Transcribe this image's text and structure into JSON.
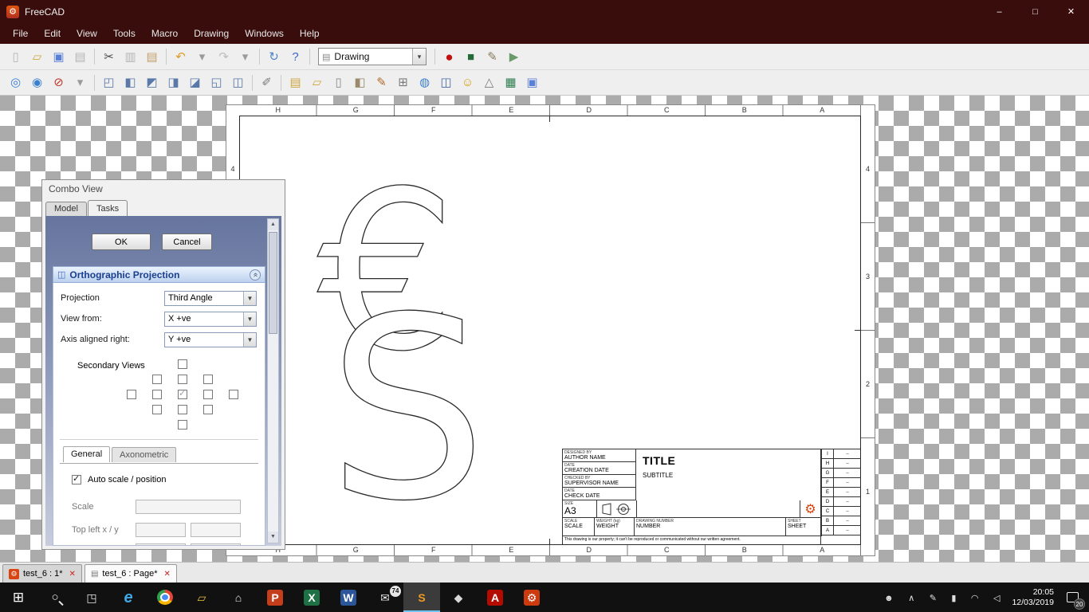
{
  "window": {
    "title": "FreeCAD",
    "controls": {
      "minimize": "–",
      "maximize": "□",
      "close": "✕"
    }
  },
  "menubar": {
    "items": [
      "File",
      "Edit",
      "View",
      "Tools",
      "Macro",
      "Drawing",
      "Windows",
      "Help"
    ]
  },
  "toolbar1": {
    "workbench": "Drawing",
    "workbench_icon": "▤",
    "workbench_caret": "▾",
    "items": [
      {
        "name": "new-document-button",
        "glyph": "▯",
        "color": "#b5b5b5"
      },
      {
        "name": "open-document-button",
        "glyph": "▱",
        "color": "#cfa63f"
      },
      {
        "name": "save-button",
        "glyph": "▣",
        "color": "#5a7fd6"
      },
      {
        "name": "print-button",
        "glyph": "▤",
        "color": "#b5b5b5"
      },
      {
        "name": "separator",
        "sep": true,
        "inter": "false"
      },
      {
        "name": "cut-button",
        "glyph": "✂",
        "color": "#4a4a4a"
      },
      {
        "name": "copy-button",
        "glyph": "▥",
        "color": "#b5b5b5"
      },
      {
        "name": "paste-button",
        "glyph": "▤",
        "color": "#c2a06a"
      },
      {
        "name": "separator",
        "sep": true,
        "inter": "false"
      },
      {
        "name": "undo-button",
        "glyph": "↶",
        "color": "#e09a2a"
      },
      {
        "name": "undo-dropdown",
        "glyph": "▾",
        "color": "#9a9a9a"
      },
      {
        "name": "redo-button",
        "glyph": "↷",
        "color": "#bdbdbd"
      },
      {
        "name": "redo-dropdown",
        "glyph": "▾",
        "color": "#9a9a9a"
      },
      {
        "name": "separator",
        "sep": true,
        "inter": "false"
      },
      {
        "name": "refresh-button",
        "glyph": "↻",
        "color": "#4a86c8"
      },
      {
        "name": "whats-this-button",
        "glyph": "?",
        "color": "#3a66c8"
      },
      {
        "name": "separator",
        "sep": true,
        "inter": "false"
      }
    ],
    "macro_items": [
      {
        "name": "separator",
        "sep": true,
        "inter": "false"
      },
      {
        "name": "macro-record-button",
        "glyph": "●",
        "color": "#c01010"
      },
      {
        "name": "macro-stop-button",
        "glyph": "■",
        "color": "#256b38"
      },
      {
        "name": "macro-edit-button",
        "glyph": "✎",
        "color": "#8a7a5a"
      },
      {
        "name": "macro-execute-button",
        "glyph": "▶",
        "color": "#6a9a6a"
      }
    ]
  },
  "toolbar2": {
    "items": [
      {
        "name": "fit-all-button",
        "glyph": "◎",
        "color": "#3a7fd0"
      },
      {
        "name": "zoom-selection-button",
        "glyph": "◉",
        "color": "#3a7fd0"
      },
      {
        "name": "draw-style-button",
        "glyph": "⊘",
        "color": "#c0392b"
      },
      {
        "name": "draw-style-dropdown",
        "glyph": "▾",
        "color": "#9a9a9a"
      },
      {
        "name": "separator",
        "sep": true,
        "inter": "false"
      },
      {
        "name": "view-axonometric-button",
        "glyph": "◰",
        "color": "#5b79a8"
      },
      {
        "name": "view-front-button",
        "glyph": "◧",
        "color": "#5b79a8"
      },
      {
        "name": "view-top-button",
        "glyph": "◩",
        "color": "#5b79a8"
      },
      {
        "name": "view-right-button",
        "glyph": "◨",
        "color": "#5b79a8"
      },
      {
        "name": "view-rear-button",
        "glyph": "◪",
        "color": "#5b79a8"
      },
      {
        "name": "view-bottom-button",
        "glyph": "◱",
        "color": "#5b79a8"
      },
      {
        "name": "view-left-button",
        "glyph": "◫",
        "color": "#5b79a8"
      },
      {
        "name": "separator",
        "sep": true,
        "inter": "false"
      },
      {
        "name": "measure-distance-button",
        "glyph": "✐",
        "color": "#7a7a7a"
      },
      {
        "name": "separator",
        "sep": true,
        "inter": "false"
      },
      {
        "name": "drawing-new-page-button",
        "glyph": "▤",
        "color": "#cfa63f"
      },
      {
        "name": "drawing-open-svg-button",
        "glyph": "▱",
        "color": "#cfa63f"
      },
      {
        "name": "drawing-new-a3-page-button",
        "glyph": "▯",
        "color": "#8a8a8a"
      },
      {
        "name": "drawing-insert-view-button",
        "glyph": "◧",
        "color": "#9a8a6a"
      },
      {
        "name": "drawing-annotation-button",
        "glyph": "✎",
        "color": "#b06a2a"
      },
      {
        "name": "drawing-clip-button",
        "glyph": "⊞",
        "color": "#7a7a7a"
      },
      {
        "name": "drawing-open-browser-button",
        "glyph": "◍",
        "color": "#3a7fd0"
      },
      {
        "name": "drawing-ortho-views-button",
        "glyph": "◫",
        "color": "#4a6aa8"
      },
      {
        "name": "drawing-symbol-button",
        "glyph": "☺",
        "color": "#d6a018"
      },
      {
        "name": "drawing-draft-view-button",
        "glyph": "△",
        "color": "#7a7a7a"
      },
      {
        "name": "drawing-spreadsheet-view-button",
        "glyph": "▦",
        "color": "#2e7d4f"
      },
      {
        "name": "drawing-save-page-button",
        "glyph": "▣",
        "color": "#5a7fd6"
      }
    ]
  },
  "combo_view": {
    "title": "Combo View",
    "tabs": [
      {
        "name": "tab-model",
        "label": "Model"
      },
      {
        "name": "tab-tasks",
        "label": "Tasks",
        "active": true
      }
    ],
    "ok_label": "OK",
    "cancel_label": "Cancel",
    "section_icon": "◫",
    "section_title": "Orthographic Projection",
    "collapse_glyph": "«",
    "rows": [
      {
        "label": "Projection",
        "value": "Third Angle"
      },
      {
        "label": "View from:",
        "value": "X +ve"
      },
      {
        "label": "Axis aligned right:",
        "value": "Y +ve"
      }
    ],
    "secondary_views_label": "Secondary Views",
    "checkbox_grid": [
      {
        "s": "n"
      },
      {
        "s": "n"
      },
      {
        "s": "o"
      },
      {
        "s": "n"
      },
      {
        "s": "n"
      },
      {
        "s": "n"
      },
      {
        "s": "o"
      },
      {
        "s": "o"
      },
      {
        "s": "o"
      },
      {
        "s": "n"
      },
      {
        "s": "o"
      },
      {
        "s": "o"
      },
      {
        "s": "c"
      },
      {
        "s": "o"
      },
      {
        "s": "o"
      },
      {
        "s": "n"
      },
      {
        "s": "o"
      },
      {
        "s": "o"
      },
      {
        "s": "o"
      },
      {
        "s": "n"
      },
      {
        "s": "n"
      },
      {
        "s": "n"
      },
      {
        "s": "o"
      },
      {
        "s": "n"
      },
      {
        "s": "n"
      }
    ],
    "inner_tabs": [
      {
        "name": "tab-general",
        "label": "General",
        "active": true
      },
      {
        "name": "tab-axonometric",
        "label": "Axonometric"
      }
    ],
    "auto_scale_label": "Auto scale / position",
    "auto_scale_state": "on",
    "scale_label": "Scale",
    "topleft_label": "Top left x / y"
  },
  "sheet": {
    "zone_letters": [
      "H",
      "G",
      "F",
      "E",
      "D",
      "C",
      "B",
      "A"
    ],
    "zone_numbers": [
      "4",
      "3",
      "2",
      "1"
    ],
    "sketch_glyphs": [
      "€",
      "S"
    ],
    "rev_rows": [
      {
        "letter": "I",
        "mark": "–"
      },
      {
        "letter": "H",
        "mark": "–"
      },
      {
        "letter": "G",
        "mark": "–"
      },
      {
        "letter": "F",
        "mark": "–"
      },
      {
        "letter": "E",
        "mark": "–"
      },
      {
        "letter": "D",
        "mark": "–"
      },
      {
        "letter": "C",
        "mark": "–"
      },
      {
        "letter": "B",
        "mark": "–"
      },
      {
        "letter": "A",
        "mark": "–"
      }
    ],
    "title_block": {
      "designed_caption": "DESIGNED BY",
      "author": "AUTHOR NAME",
      "date1_caption": "DATE",
      "creation_date": "CREATION DATE",
      "checked_caption": "CHECKED BY",
      "supervisor": "SUPERVISOR NAME",
      "date2_caption": "DATE",
      "check_date": "CHECK DATE",
      "size_caption": "SIZE",
      "size": "A3",
      "title": "TITLE",
      "subtitle": "SUBTITLE",
      "scale_caption": "SCALE",
      "scale": "SCALE",
      "weight_caption": "WEIGHT (kg)",
      "weight": "WEIGHT",
      "number_caption": "DRAWING NUMBER",
      "number": "NUMBER",
      "sheet_caption": "SHEET",
      "sheet": "SHEET",
      "disclaimer": "This drawing is our property; it can't be reproduced or communicated without our written agreement."
    }
  },
  "mdi_tabs": {
    "tabs": [
      {
        "name": "mdi-tab-model",
        "icon": "⚙",
        "label": "test_6 : 1*",
        "close": "✕"
      },
      {
        "name": "mdi-tab-page",
        "icon": "▤",
        "label": "test_6 : Page*",
        "close": "✕",
        "active": true
      }
    ]
  },
  "taskbar": {
    "apps": [
      {
        "name": "taskbar-start-button",
        "glyph": "⊞",
        "color": "#ffffff"
      },
      {
        "name": "taskbar-search-button",
        "glyph": "○",
        "color": "#e8e8e8"
      },
      {
        "name": "taskbar-task-view-button",
        "glyph": "◳",
        "color": "#e8e8e8"
      },
      {
        "name": "taskbar-app-edge",
        "glyph": "e",
        "color": "#3fa9e8"
      },
      {
        "name": "taskbar-app-chrome",
        "glyph": "●",
        "color": "#e84335"
      },
      {
        "name": "taskbar-app-explorer",
        "glyph": "▱",
        "color": "#eec33e"
      },
      {
        "name": "taskbar-app-store",
        "glyph": "⌂",
        "color": "#e8e8e8"
      },
      {
        "name": "taskbar-app-powerpoint",
        "glyph": "P",
        "color": "#ffffff",
        "bg": "#c43e1c"
      },
      {
        "name": "taskbar-app-excel",
        "glyph": "X",
        "color": "#ffffff",
        "bg": "#1e7145"
      },
      {
        "name": "taskbar-app-word",
        "glyph": "W",
        "color": "#ffffff",
        "bg": "#2b579a"
      },
      {
        "name": "taskbar-app-mail",
        "glyph": "✉",
        "color": "#e8e8e8",
        "badge": "74"
      },
      {
        "name": "taskbar-app-s",
        "glyph": "S",
        "color": "#f29a1f",
        "active": true
      },
      {
        "name": "taskbar-app-inkscape",
        "glyph": "◆",
        "color": "#d8d8d8"
      },
      {
        "name": "taskbar-app-acrobat",
        "glyph": "A",
        "color": "#ffffff",
        "bg": "#b30b00"
      },
      {
        "name": "taskbar-app-freecad",
        "glyph": "⚙",
        "color": "#ffffff",
        "bg": "#cc3a10"
      }
    ],
    "tray_icons": [
      {
        "name": "tray-people-icon",
        "glyph": "☻"
      },
      {
        "name": "tray-hidden-icons-chevron",
        "glyph": "∧"
      },
      {
        "name": "tray-pen-icon",
        "glyph": "✎"
      },
      {
        "name": "tray-battery-icon",
        "glyph": "▮"
      },
      {
        "name": "tray-network-icon",
        "glyph": "◠"
      },
      {
        "name": "tray-volume-icon",
        "glyph": "◁"
      }
    ],
    "time": "20:05",
    "date": "12/03/2019",
    "action_center_badge": "20"
  }
}
